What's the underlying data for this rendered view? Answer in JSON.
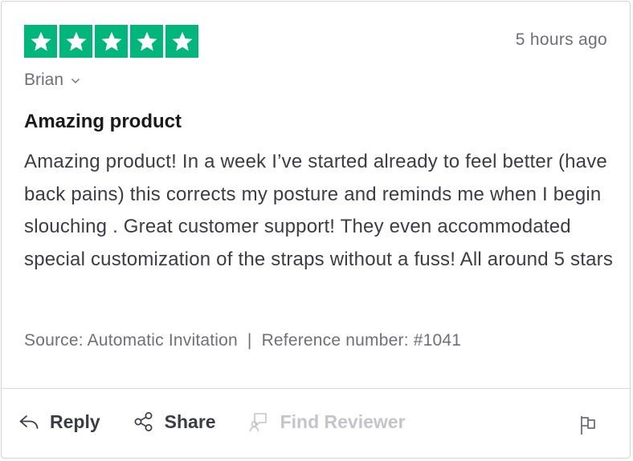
{
  "review": {
    "rating": 5,
    "rating_max": 5,
    "star_color": "#00b67a",
    "time_ago": "5 hours ago",
    "author": "Brian",
    "title": "Amazing product",
    "body": "Amazing product! In a week I’ve started already to feel better (have back pains) this corrects my posture and reminds me when I begin slouching . Great customer support! They even accommodated special customization of the straps without a fuss! All around 5 stars",
    "source": "Source: Automatic Invitation",
    "separator": "|",
    "reference": "Reference number: #1041"
  },
  "actions": {
    "reply_label": "Reply",
    "reply_icon": "reply-arrow-icon",
    "share_label": "Share",
    "share_icon": "share-icon",
    "find_reviewer_label": "Find Reviewer",
    "find_reviewer_icon": "find-reviewer-icon",
    "flag_icon": "flag-icon"
  }
}
